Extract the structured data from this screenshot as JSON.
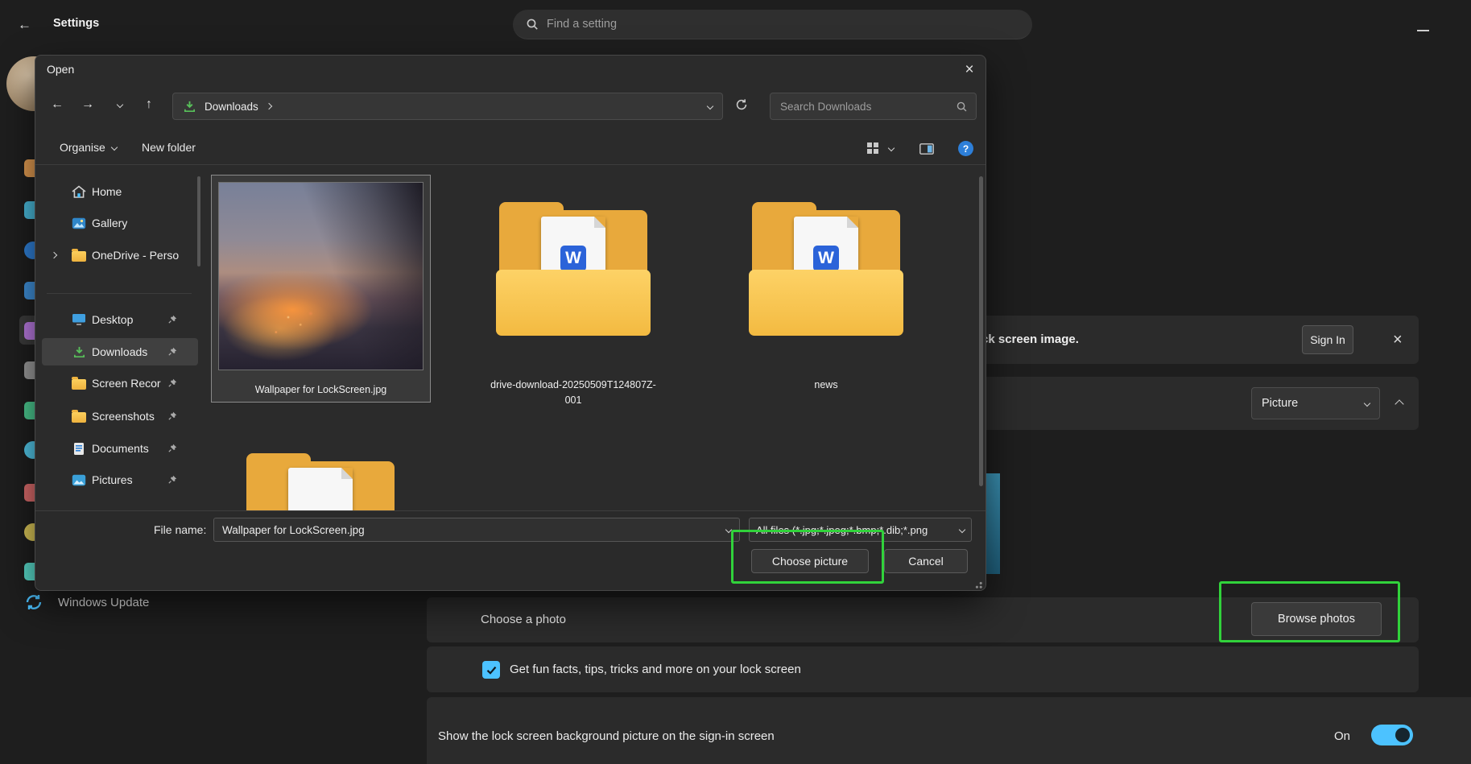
{
  "colors": {
    "accent_blue": "#4cc2ff",
    "annotation_green": "#31d23b",
    "folder_yellow": "#f3ba41",
    "word_doc_blue": "#2b63d9"
  },
  "settings": {
    "window_title": "Settings",
    "search": {
      "placeholder": "Find a setting"
    },
    "windows_update_label": "Windows Update",
    "lockscreen": {
      "banner_text": "ck screen image.",
      "sign_in_button": "Sign In",
      "picture_dropdown_value": "Picture",
      "choose_photo_label": "Choose a photo",
      "browse_photos_button": "Browse photos",
      "fun_facts_label": "Get fun facts, tips, tricks and more on your lock screen",
      "sign_in_screen_label": "Show the lock screen background picture on the sign-in screen",
      "toggle_state_label": "On"
    }
  },
  "dialog": {
    "title": "Open",
    "address": {
      "crumb": "Downloads"
    },
    "search_placeholder": "Search Downloads",
    "toolbar": {
      "organise_label": "Organise",
      "new_folder_label": "New folder"
    },
    "sidebar": {
      "items": [
        {
          "label": "Home",
          "icon": "home-icon",
          "pinned": false
        },
        {
          "label": "Gallery",
          "icon": "gallery-icon",
          "pinned": false
        },
        {
          "label": "OneDrive - Perso",
          "icon": "onedrive-folder-icon",
          "expandable": true
        },
        {
          "label": "Desktop",
          "icon": "desktop-icon",
          "pinned": true
        },
        {
          "label": "Downloads",
          "icon": "downloads-icon",
          "pinned": true,
          "selected": true
        },
        {
          "label": "Screen Recor",
          "icon": "folder-icon",
          "pinned": true
        },
        {
          "label": "Screenshots",
          "icon": "folder-icon",
          "pinned": true
        },
        {
          "label": "Documents",
          "icon": "documents-icon",
          "pinned": true
        },
        {
          "label": "Pictures",
          "icon": "pictures-icon",
          "pinned": true
        }
      ]
    },
    "files": [
      {
        "name": "Wallpaper for LockScreen.jpg",
        "kind": "image",
        "selected": true
      },
      {
        "name": "drive-download-20250509T124807Z-001",
        "kind": "folder-with-word-doc"
      },
      {
        "name": "news",
        "kind": "folder-with-word-doc"
      },
      {
        "name": "",
        "kind": "folder"
      }
    ],
    "footer": {
      "file_name_label": "File name:",
      "file_name_value": "Wallpaper for LockScreen.jpg",
      "file_type_value": "All files (*.jpg;*.jpeg;*.bmp;*.dib;*.png",
      "choose_picture_button": "Choose picture",
      "cancel_button": "Cancel"
    }
  }
}
